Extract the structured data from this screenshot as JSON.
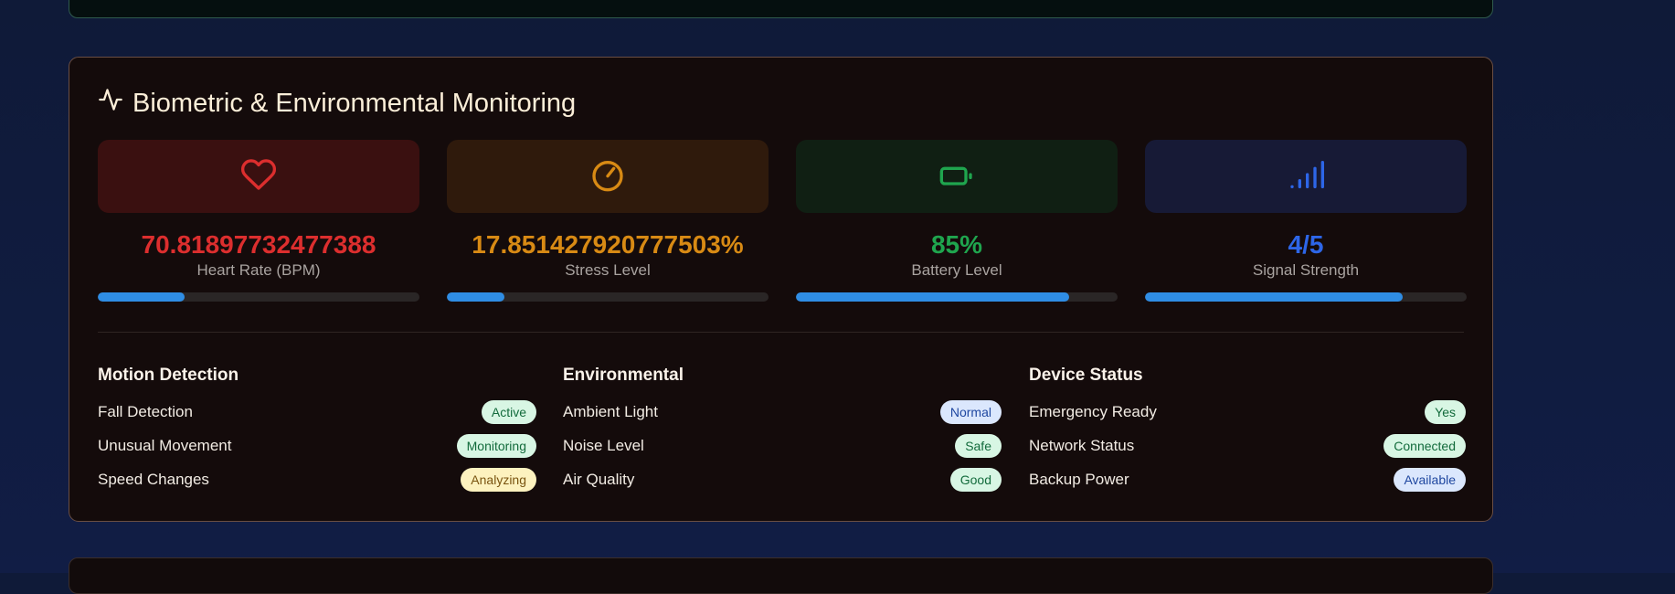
{
  "section": {
    "title": "Biometric & Environmental Monitoring",
    "icon": "activity-icon"
  },
  "metrics": [
    {
      "value": "70.81897732477388",
      "label": "Heart Rate (BPM)",
      "icon": "heart-icon",
      "color": "#dc2e2e",
      "tile_bg": "#3a1010",
      "progress_pct": 27
    },
    {
      "value": "17.851427920777503%",
      "label": "Stress Level",
      "icon": "gauge-icon",
      "color": "#d88a14",
      "tile_bg": "#2f1a0c",
      "progress_pct": 18
    },
    {
      "value": "85%",
      "label": "Battery Level",
      "icon": "battery-icon",
      "color": "#1fa54e",
      "tile_bg": "#101f13",
      "progress_pct": 85
    },
    {
      "value": "4/5",
      "label": "Signal Strength",
      "icon": "signal-icon",
      "color": "#2d66e8",
      "tile_bg": "#171a36",
      "progress_pct": 80
    }
  ],
  "groups": [
    {
      "title": "Motion Detection",
      "items": [
        {
          "label": "Fall Detection",
          "status": "Active",
          "tone": "green"
        },
        {
          "label": "Unusual Movement",
          "status": "Monitoring",
          "tone": "green"
        },
        {
          "label": "Speed Changes",
          "status": "Analyzing",
          "tone": "yellow"
        }
      ]
    },
    {
      "title": "Environmental",
      "items": [
        {
          "label": "Ambient Light",
          "status": "Normal",
          "tone": "blue"
        },
        {
          "label": "Noise Level",
          "status": "Safe",
          "tone": "green"
        },
        {
          "label": "Air Quality",
          "status": "Good",
          "tone": "green"
        }
      ]
    },
    {
      "title": "Device Status",
      "items": [
        {
          "label": "Emergency Ready",
          "status": "Yes",
          "tone": "green"
        },
        {
          "label": "Network Status",
          "status": "Connected",
          "tone": "green"
        },
        {
          "label": "Backup Power",
          "status": "Available",
          "tone": "blue"
        }
      ]
    }
  ]
}
